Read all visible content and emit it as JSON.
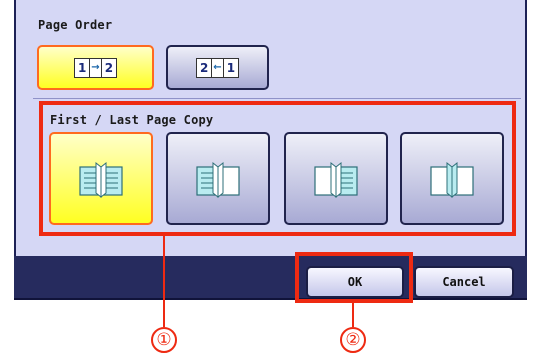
{
  "page_order": {
    "label": "Page Order",
    "options": [
      {
        "left": "1",
        "mid": "→",
        "right": "2",
        "selected": true
      },
      {
        "left": "2",
        "mid": "←",
        "right": "1",
        "selected": false
      }
    ]
  },
  "first_last_copy": {
    "label": "First / Last Page Copy",
    "options": [
      {
        "name": "book-open-both-pages-icon",
        "selected": true
      },
      {
        "name": "book-left-page-icon",
        "selected": false
      },
      {
        "name": "book-right-page-icon",
        "selected": false
      },
      {
        "name": "book-cover-only-icon",
        "selected": false
      }
    ]
  },
  "footer": {
    "ok_label": "OK",
    "cancel_label": "Cancel"
  },
  "callouts": [
    "①",
    "②"
  ],
  "colors": {
    "highlight": "#ee2a12",
    "selected_bg": "#ffff22",
    "panel_bg": "#d5d7f5",
    "footer_bg": "#262b5e"
  }
}
